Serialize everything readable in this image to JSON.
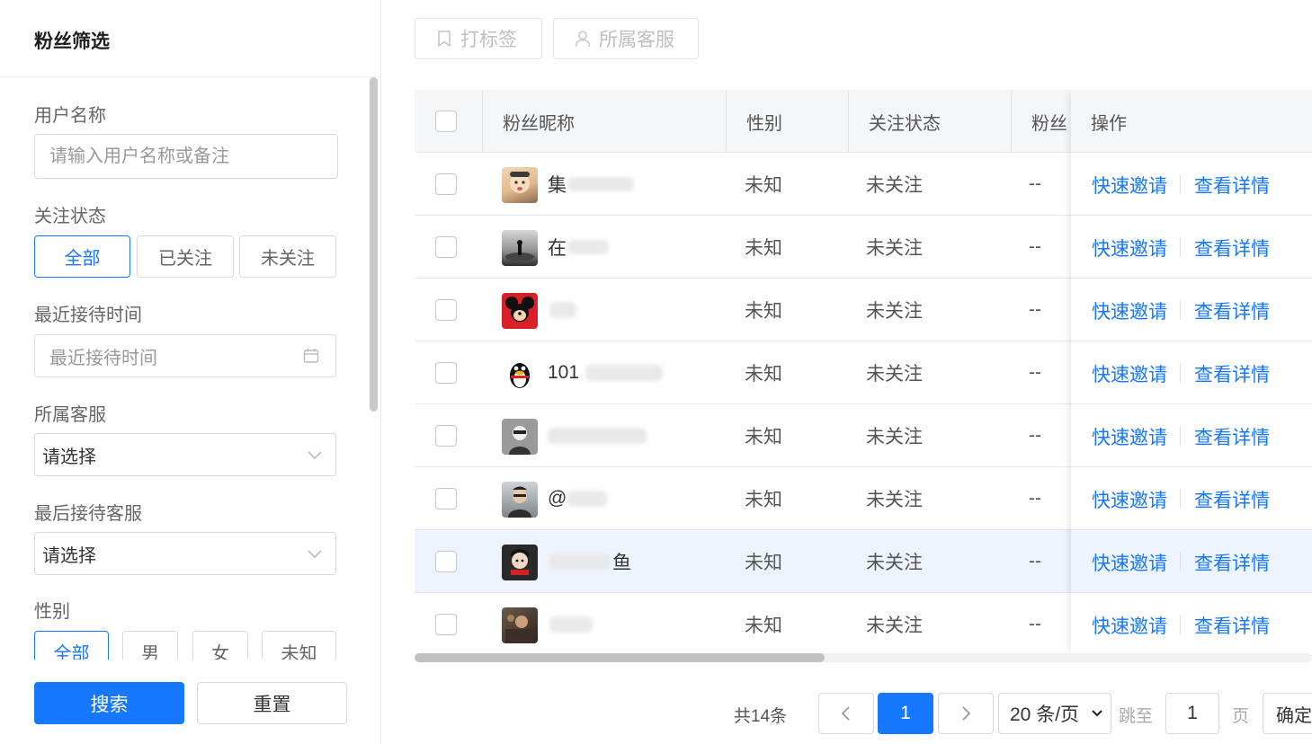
{
  "filter": {
    "title": "粉丝筛选",
    "username": {
      "label": "用户名称",
      "placeholder": "请输入用户名称或备注"
    },
    "follow_status": {
      "label": "关注状态",
      "options": [
        "全部",
        "已关注",
        "未关注"
      ]
    },
    "recent_time": {
      "label": "最近接待时间",
      "placeholder": "最近接待时间"
    },
    "service": {
      "label": "所属客服",
      "value": "请选择"
    },
    "last_service": {
      "label": "最后接待客服",
      "value": "请选择"
    },
    "gender": {
      "label": "性别",
      "options": [
        "全部",
        "男",
        "女",
        "未知"
      ]
    },
    "search_label": "搜索",
    "reset_label": "重置"
  },
  "toolbar": {
    "tag_label": "打标签",
    "service_label": "所属客服"
  },
  "table": {
    "headers": {
      "nickname": "粉丝昵称",
      "gender": "性别",
      "status": "关注状态",
      "more": "粉丝",
      "ops": "操作"
    },
    "rows": [
      {
        "nick": "集",
        "gender": "未知",
        "status": "未关注",
        "more": "--",
        "invite": "快速邀请",
        "detail": "查看详情"
      },
      {
        "nick": "在",
        "gender": "未知",
        "status": "未关注",
        "more": "--",
        "invite": "快速邀请",
        "detail": "查看详情"
      },
      {
        "nick": "",
        "gender": "未知",
        "status": "未关注",
        "more": "--",
        "invite": "快速邀请",
        "detail": "查看详情"
      },
      {
        "nick": "101",
        "gender": "未知",
        "status": "未关注",
        "more": "--",
        "invite": "快速邀请",
        "detail": "查看详情"
      },
      {
        "nick": "",
        "gender": "未知",
        "status": "未关注",
        "more": "--",
        "invite": "快速邀请",
        "detail": "查看详情"
      },
      {
        "nick": "@",
        "gender": "未知",
        "status": "未关注",
        "more": "--",
        "invite": "快速邀请",
        "detail": "查看详情"
      },
      {
        "nick": "鱼",
        "gender": "未知",
        "status": "未关注",
        "more": "--",
        "invite": "快速邀请",
        "detail": "查看详情"
      },
      {
        "nick": "",
        "gender": "未知",
        "status": "未关注",
        "more": "--",
        "invite": "快速邀请",
        "detail": "查看详情"
      }
    ]
  },
  "pagination": {
    "total": "共14条",
    "current": "1",
    "page_size": "20 条/页",
    "goto_label": "跳至",
    "goto_value": "1",
    "page_suffix": "页",
    "confirm": "确定"
  },
  "colors": {
    "accent": "#1677ff",
    "highlight_row": "#eef4fe",
    "header_bg": "#f5f6f8"
  }
}
